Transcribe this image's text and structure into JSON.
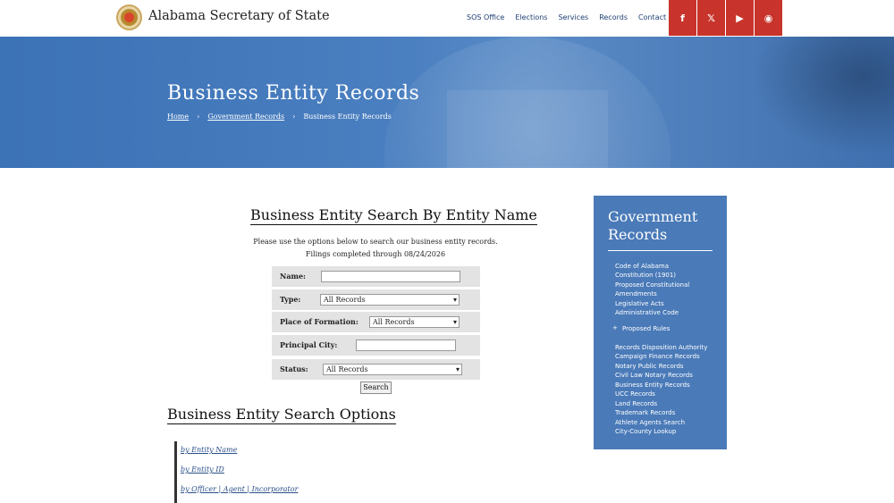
{
  "header": {
    "site_title": "Alabama Secretary of State",
    "nav": [
      "SOS Office",
      "Elections",
      "Services",
      "Records",
      "Contact"
    ],
    "social": [
      {
        "icon": "facebook-icon",
        "glyph": "f"
      },
      {
        "icon": "x-twitter-icon",
        "glyph": "𝕏"
      },
      {
        "icon": "youtube-icon",
        "glyph": "▶"
      },
      {
        "icon": "rss-icon",
        "glyph": "◉"
      }
    ],
    "social_color": "#c8342b"
  },
  "hero": {
    "title": "Business Entity Records",
    "breadcrumb": [
      "Home",
      "Government Records",
      "Business Entity Records"
    ],
    "breadcrumb_separator": "›"
  },
  "search": {
    "heading": "Business Entity Search By Entity Name",
    "intro_line1": "Please use the options below to search our business entity records.",
    "intro_line2": "Filings completed through 08/24/2026",
    "fields": {
      "name_label": "Name:",
      "name_value": "",
      "type_label": "Type:",
      "type_value": "All Records",
      "formation_label": "Place of Formation:",
      "formation_value": "All Records",
      "city_label": "Principal City:",
      "city_value": "",
      "status_label": "Status:",
      "status_value": "All Records"
    },
    "button": "Search"
  },
  "options": {
    "heading": "Business Entity Search Options",
    "links": [
      "by Entity Name",
      "by Entity ID",
      "by Officer | Agent | Incorporator"
    ]
  },
  "sidebar": {
    "title_line1": "Government",
    "title_line2": "Records",
    "items": [
      "Code of Alabama",
      "Constitution (1901)",
      "Proposed Constitutional",
      "Amendments",
      "Legislative Acts",
      "Administrative Code",
      "Proposed Rules",
      "Records Disposition Authority",
      "Campaign Finance Records",
      "Notary Public Records",
      "Civil Law Notary Records",
      "Business Entity Records",
      "UCC Records",
      "Land Records",
      "Trademark Records",
      "Athlete Agents Search",
      "City-County Lookup"
    ],
    "bullet": "+"
  }
}
